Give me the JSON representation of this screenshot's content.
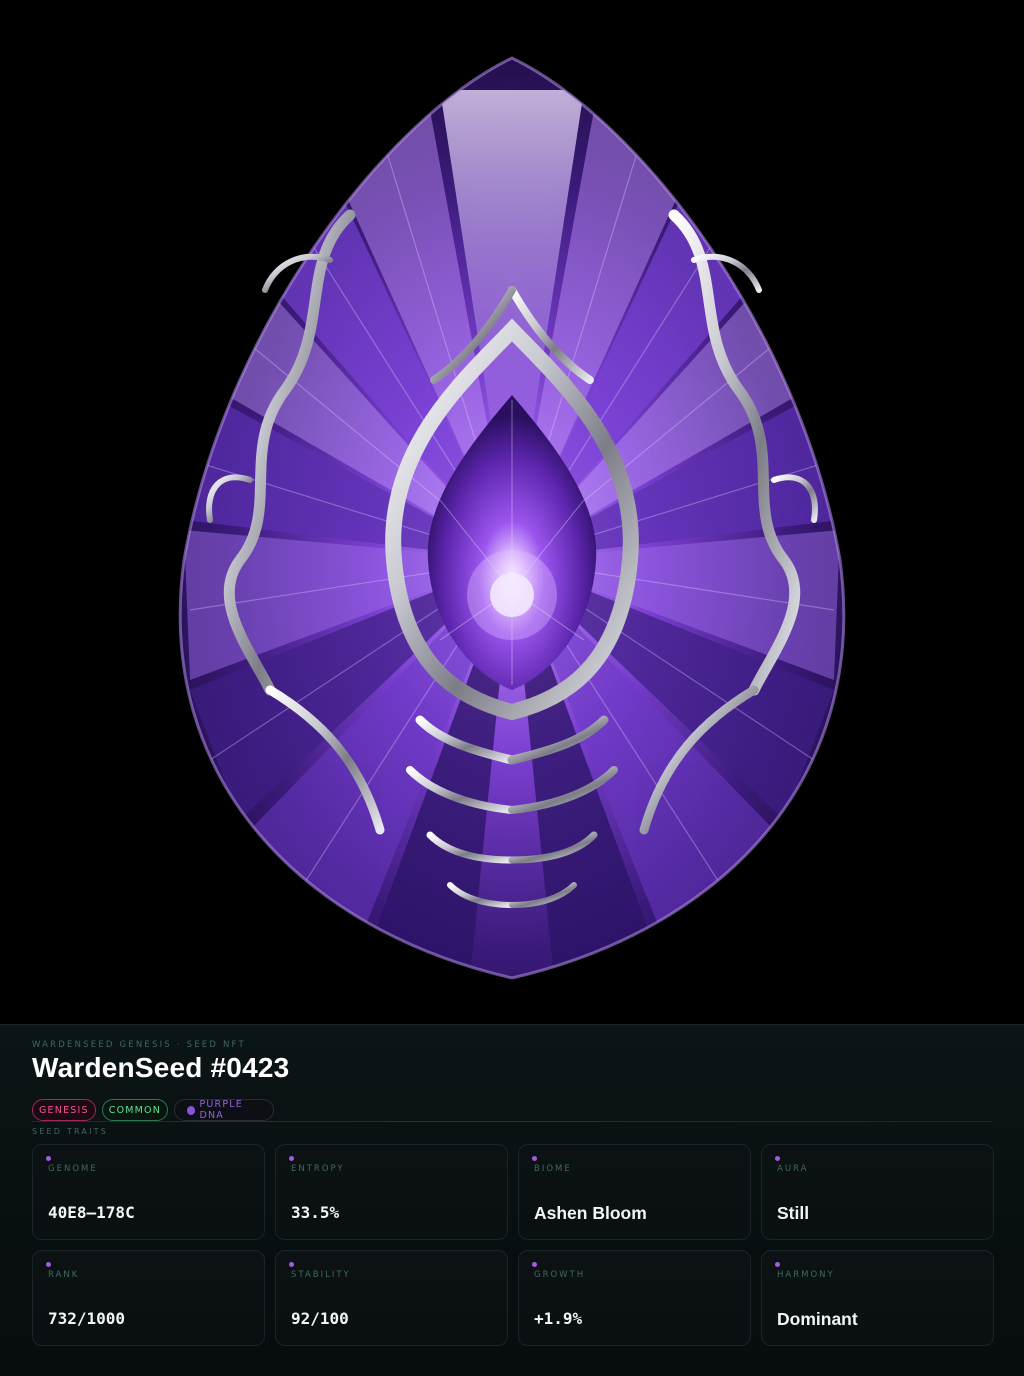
{
  "panel": {
    "eyebrow": "WARDENSEED GENESIS · SEED NFT",
    "title": "WardenSeed #0423",
    "badges": {
      "genesis": "GENESIS",
      "common": "COMMON",
      "dna": "PURPLE DNA"
    },
    "section_label": "SEED TRAITS",
    "traits": [
      {
        "label": "GENOME",
        "value": "40E8–178C"
      },
      {
        "label": "ENTROPY",
        "value": "33.5%"
      },
      {
        "label": "BIOME",
        "value": "Ashen Bloom"
      },
      {
        "label": "AURA",
        "value": "Still"
      },
      {
        "label": "RANK",
        "value": "732/1000"
      },
      {
        "label": "STABILITY",
        "value": "92/100"
      },
      {
        "label": "GROWTH",
        "value": "+1.9%"
      },
      {
        "label": "HARMONY",
        "value": "Dominant"
      }
    ]
  },
  "colors": {
    "background": "#000000",
    "panel": "#0a1113",
    "accent_purple": "#a35be0",
    "genesis_pink": "#ff4f9a",
    "common_green": "#5fe39a",
    "label_green": "#3f6a5e"
  },
  "artwork": {
    "icon": "amethyst-seed-gem-icon"
  }
}
